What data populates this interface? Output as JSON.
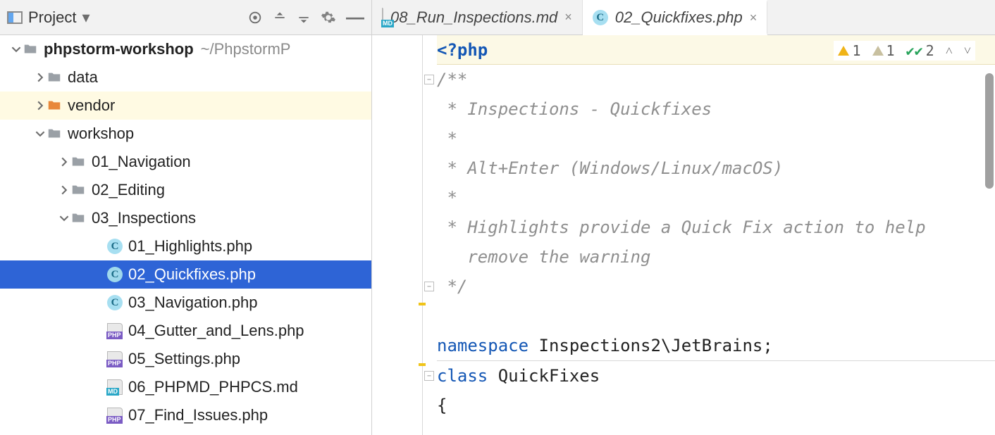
{
  "panel": {
    "title": "Project",
    "root": {
      "name": "phpstorm-workshop",
      "path": "~/PhpstormP"
    },
    "items": {
      "data": "data",
      "vendor": "vendor",
      "workshop": "workshop",
      "nav": "01_Navigation",
      "edit": "02_Editing",
      "insp": "03_Inspections",
      "f1": "01_Highlights.php",
      "f2": "02_Quickfixes.php",
      "f3": "03_Navigation.php",
      "f4": "04_Gutter_and_Lens.php",
      "f5": "05_Settings.php",
      "f6": "06_PHPMD_PHPCS.md",
      "f7": "07_Find_Issues.php"
    }
  },
  "tabs": [
    {
      "name": "08_Run_Inspections.md",
      "type": "md",
      "active": false
    },
    {
      "name": "02_Quickfixes.php",
      "type": "c",
      "active": true
    }
  ],
  "inspections": {
    "warn1": "1",
    "warn2": "1",
    "ok": "2"
  },
  "code": {
    "l1": "<?php",
    "l2": "/**",
    "l3": " * Inspections - Quickfixes",
    "l4": " *",
    "l5": " * Alt+Enter (Windows/Linux/macOS)",
    "l6": " *",
    "l7": " * Highlights provide a Quick Fix action to help",
    "l7b": "   remove the warning",
    "l8": " */",
    "l10a": "namespace",
    "l10b": " Inspections2\\JetBrains;",
    "l12a": "class",
    "l12b": " QuickFixes",
    "l13": "{"
  }
}
